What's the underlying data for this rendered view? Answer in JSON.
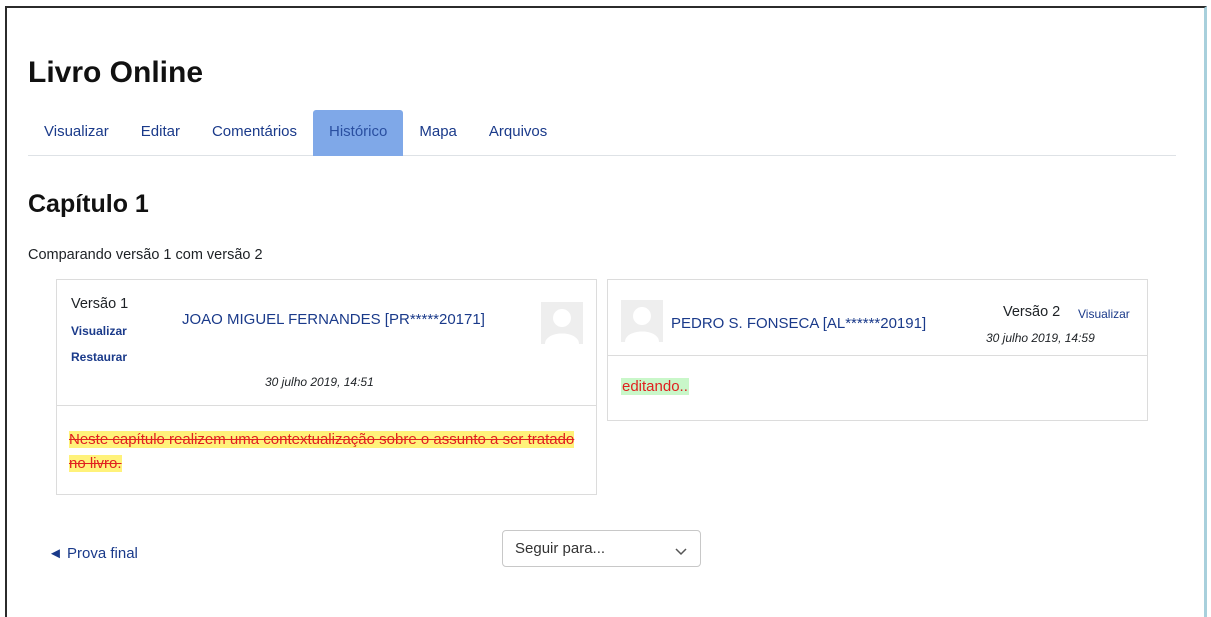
{
  "page": {
    "title": "Livro Online"
  },
  "tabs": [
    {
      "label": "Visualizar"
    },
    {
      "label": "Editar"
    },
    {
      "label": "Comentários"
    },
    {
      "label": "Histórico",
      "active": true
    },
    {
      "label": "Mapa"
    },
    {
      "label": "Arquivos"
    }
  ],
  "chapter": {
    "title": "Capítulo 1",
    "compare_text": "Comparando versão 1 com versão 2"
  },
  "left_version": {
    "label": "Versão 1",
    "view_link": "Visualizar",
    "restore_link": "Restaurar",
    "author": "JOAO MIGUEL FERNANDES [PR*****20171]",
    "date": "30 julho 2019, 14:51",
    "deleted_text": "Neste capítulo realizem uma contextualização sobre o assunto a ser tratado no livro."
  },
  "right_version": {
    "label": "Versão 2",
    "view_link": "Visualizar",
    "author": "PEDRO S. FONSECA [AL******20191]",
    "date": "30 julho 2019, 14:59",
    "inserted_text": "editando.."
  },
  "footer": {
    "prev_link": "◄ Prova final",
    "jump_select": "Seguir para..."
  },
  "colors": {
    "link": "#1a3a8a",
    "active_tab": "#7fa8e8",
    "deleted_highlight": "#fff27a",
    "inserted_highlight": "#c9f7c9",
    "diff_text": "#e02020"
  }
}
